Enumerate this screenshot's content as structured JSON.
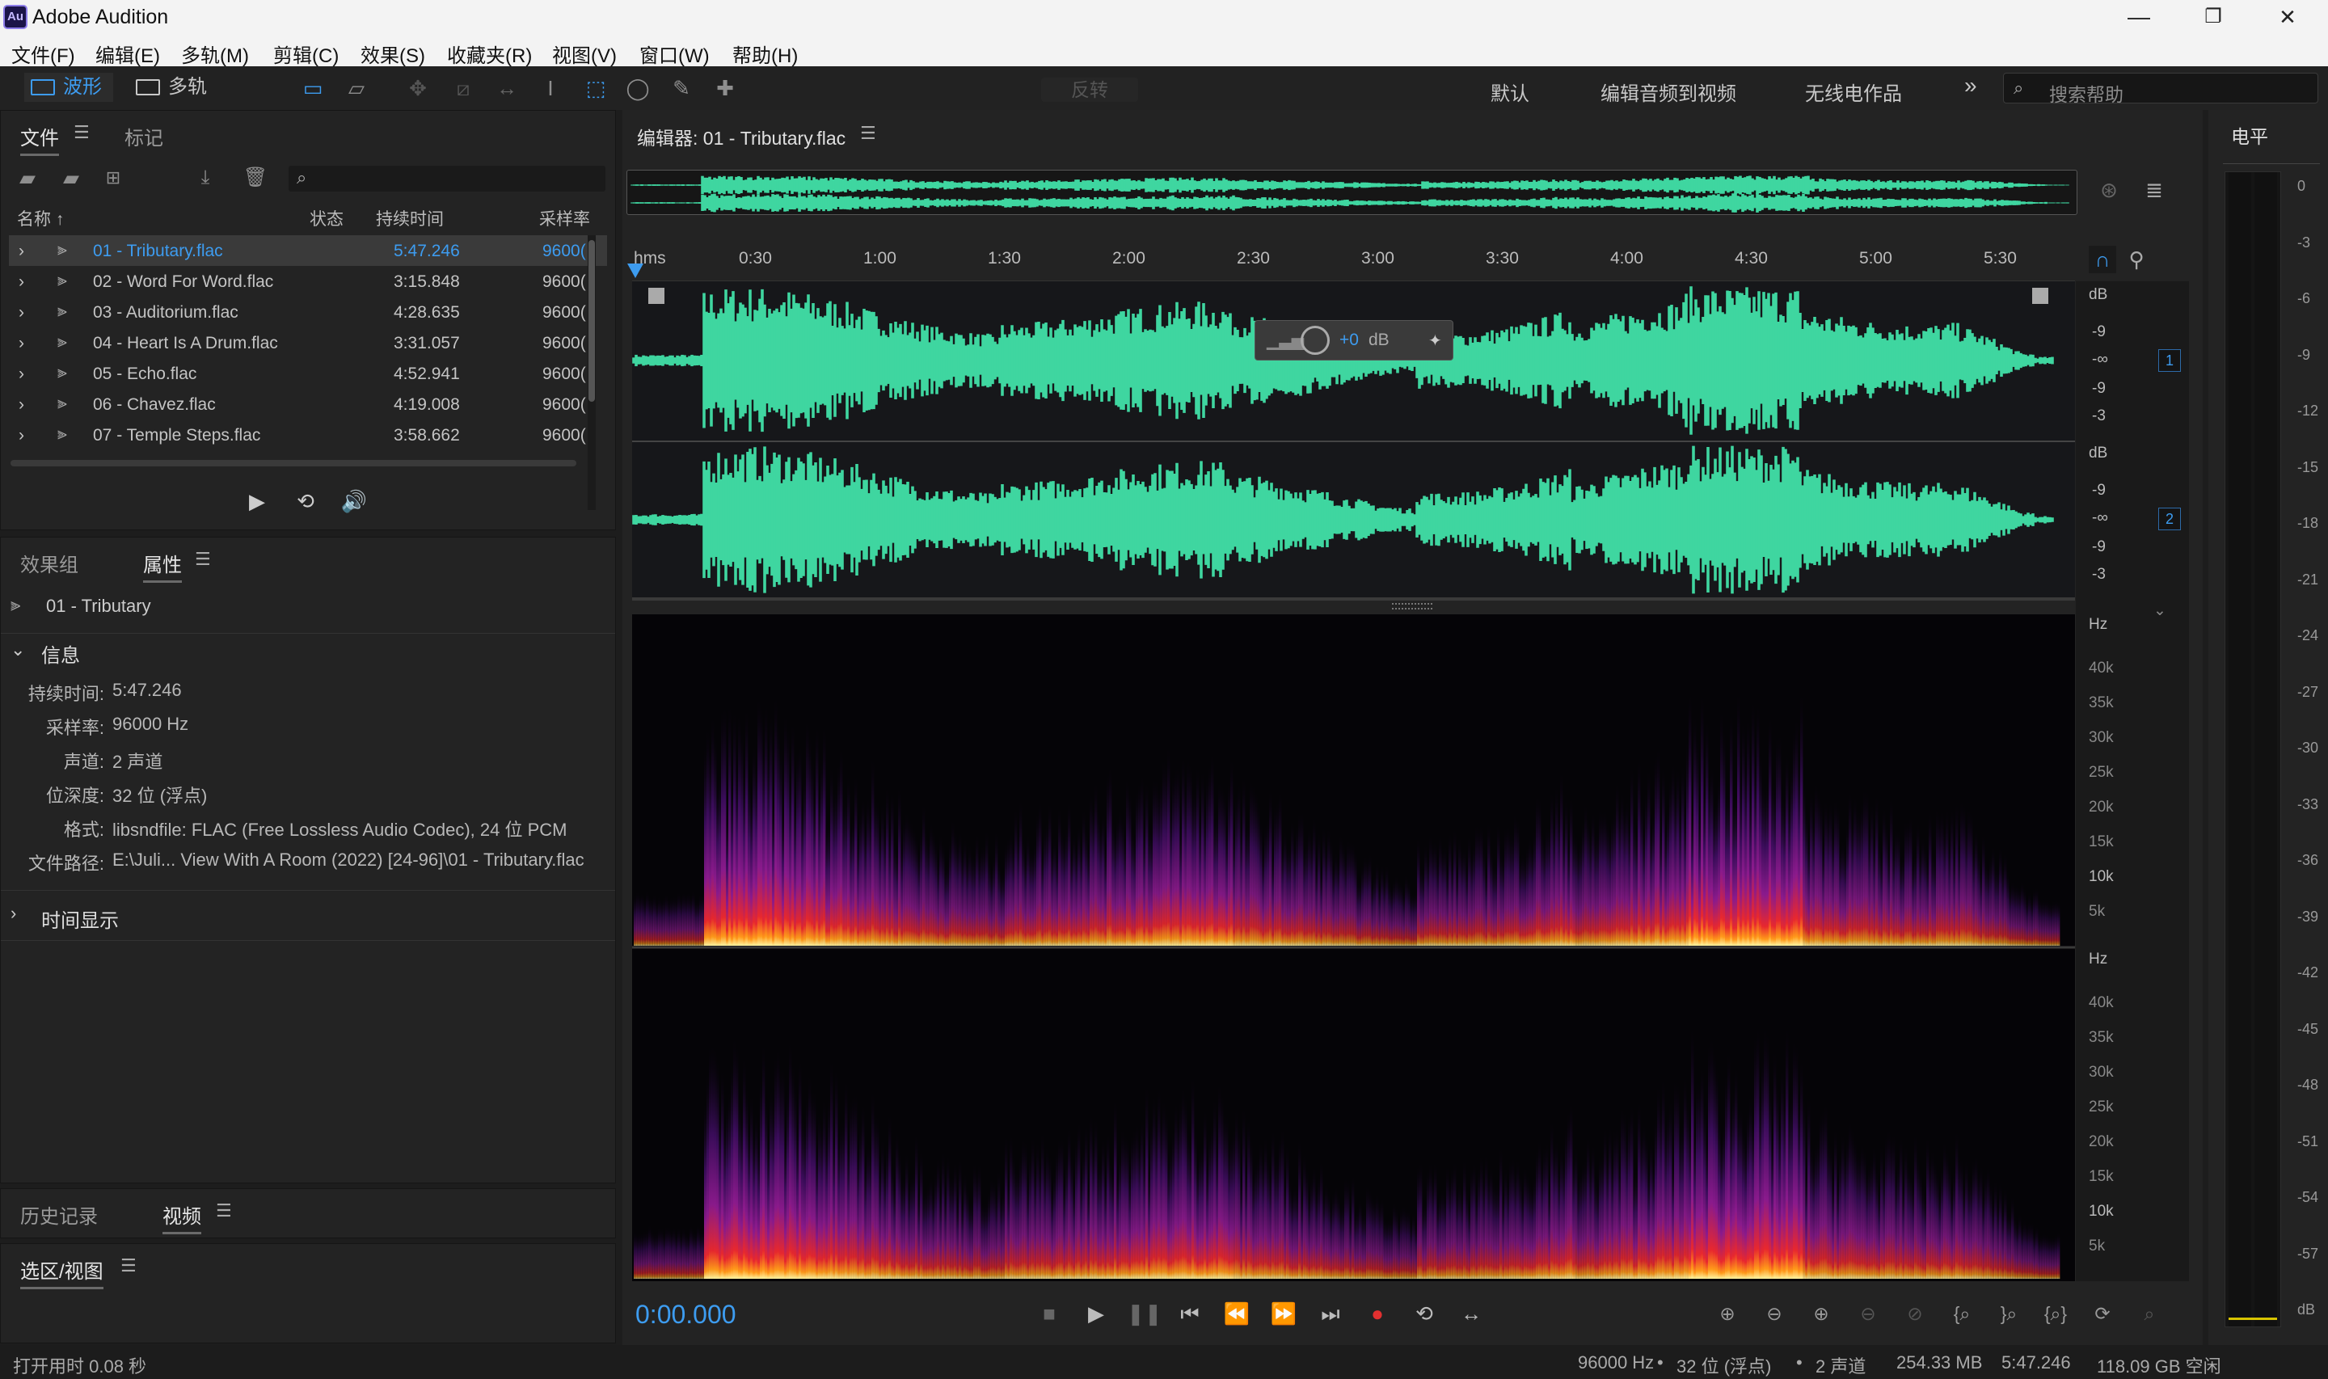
{
  "window": {
    "app_icon_text": "Au",
    "title": "Adobe Audition",
    "minimize": "—",
    "restore": "❐",
    "close": "✕"
  },
  "menu": [
    "文件(F)",
    "编辑(E)",
    "多轨(M)",
    "剪辑(C)",
    "效果(S)",
    "收藏夹(R)",
    "视图(V)",
    "窗口(W)",
    "帮助(H)"
  ],
  "toolbar": {
    "waveform_label": "波形",
    "multitrack_label": "多轨",
    "invert_label": "反转",
    "workspaces": [
      "默认",
      "编辑音频到视频",
      "无线电作品"
    ],
    "more": "»",
    "search_placeholder": "搜索帮助"
  },
  "files_panel": {
    "tabs": [
      "文件",
      "标记"
    ],
    "columns": [
      "名称",
      "状态",
      "持续时间",
      "采样率"
    ],
    "files": [
      {
        "name": "01 - Tributary.flac",
        "duration": "5:47.246",
        "rate": "9600("
      },
      {
        "name": "02 - Word For Word.flac",
        "duration": "3:15.848",
        "rate": "9600("
      },
      {
        "name": "03 - Auditorium.flac",
        "duration": "4:28.635",
        "rate": "9600("
      },
      {
        "name": "04 - Heart Is A Drum.flac",
        "duration": "3:31.057",
        "rate": "9600("
      },
      {
        "name": "05 - Echo.flac",
        "duration": "4:52.941",
        "rate": "9600("
      },
      {
        "name": "06 - Chavez.flac",
        "duration": "4:19.008",
        "rate": "9600("
      },
      {
        "name": "07 - Temple Steps.flac",
        "duration": "3:58.662",
        "rate": "9600("
      }
    ]
  },
  "properties_panel": {
    "tabs": [
      "效果组",
      "属性"
    ],
    "file_title": "01 - Tributary",
    "info_header": "信息",
    "info": [
      {
        "label": "持续时间:",
        "value": "5:47.246"
      },
      {
        "label": "采样率:",
        "value": "96000 Hz"
      },
      {
        "label": "声道:",
        "value": "2 声道"
      },
      {
        "label": "位深度:",
        "value": "32 位 (浮点)"
      },
      {
        "label": "格式:",
        "value": "libsndfile: FLAC (Free Lossless Audio Codec), 24 位 PCM"
      },
      {
        "label": "文件路径:",
        "value": "E:\\Juli... View With A Room (2022) [24-96]\\01 - Tributary.flac"
      }
    ],
    "time_display": "时间显示"
  },
  "history_panel": {
    "tabs": [
      "历史记录",
      "视频"
    ]
  },
  "selection_panel": {
    "title": "选区/视图"
  },
  "editor": {
    "title": "编辑器: 01 - Tributary.flac",
    "ruler_unit": "hms",
    "ruler_ticks": [
      "0:30",
      "1:00",
      "1:30",
      "2:00",
      "2:30",
      "3:00",
      "3:30",
      "4:00",
      "4:30",
      "5:00",
      "5:30"
    ],
    "hud_gain": "+0",
    "hud_unit": "dB",
    "db_labels": [
      "dB",
      "-9",
      "-∞",
      "-9",
      "-3"
    ],
    "hz_labels": [
      "Hz",
      "40k",
      "35k",
      "30k",
      "25k",
      "20k",
      "15k",
      "10k",
      "5k"
    ],
    "channel_1": "1",
    "channel_2": "2",
    "timecode": "0:00.000"
  },
  "meter": {
    "title": "电平",
    "scale": [
      "0",
      "-3",
      "-6",
      "-9",
      "-12",
      "-15",
      "-18",
      "-21",
      "-24",
      "-27",
      "-30",
      "-33",
      "-36",
      "-39",
      "-42",
      "-45",
      "-48",
      "-51",
      "-54",
      "-57",
      "dB"
    ]
  },
  "status": {
    "open_time": "打开用时 0.08 秒",
    "sample_rate": "96000 Hz",
    "bit_depth": "32 位 (浮点)",
    "channels": "2 声道",
    "size": "254.33 MB",
    "duration": "5:47.246",
    "free": "118.09 GB 空闲"
  },
  "colors": {
    "waveform": "#3fd6a0",
    "accent": "#3d9cf0",
    "record": "#e23030"
  }
}
